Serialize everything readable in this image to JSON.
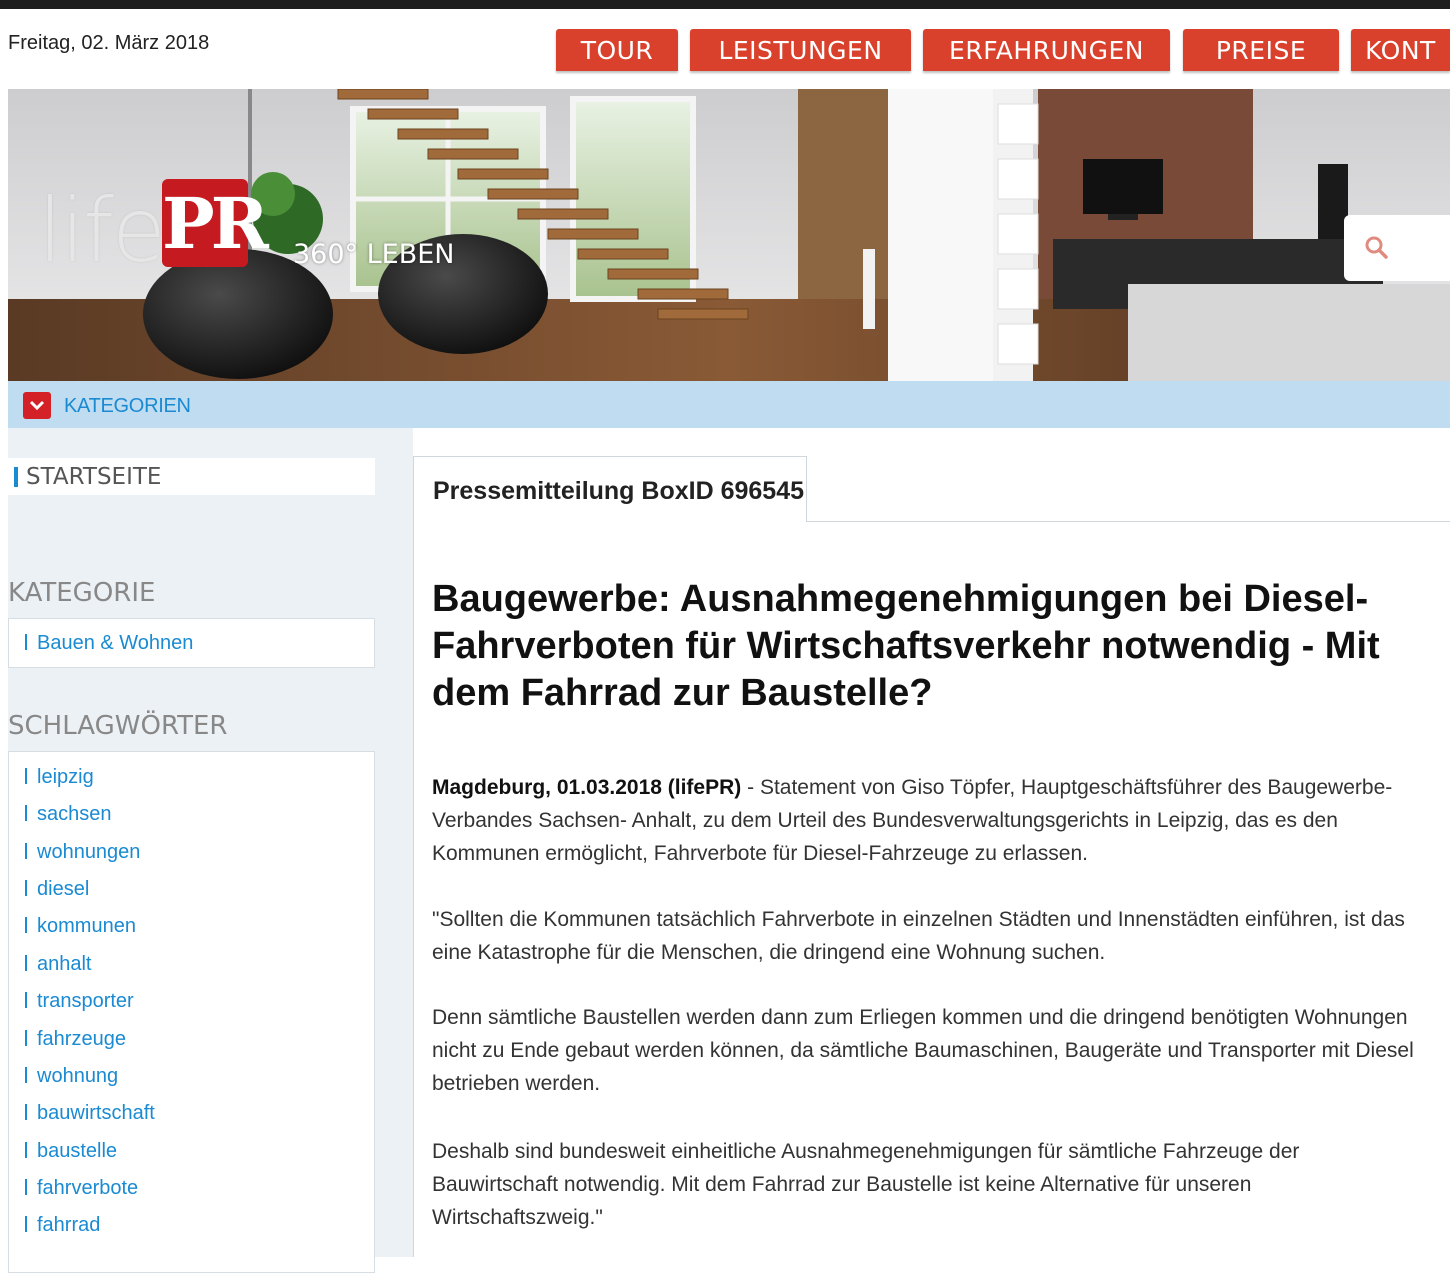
{
  "header": {
    "date": "Freitag, 02. März 2018",
    "nav": [
      "TOUR",
      "LEISTUNGEN",
      "ERFAHRUNGEN",
      "PREISE",
      "KONT"
    ]
  },
  "hero": {
    "logo_text": "life",
    "logo_badge": "PR",
    "tagline": "360° LEBEN",
    "search_icon": "search-icon"
  },
  "category_bar": {
    "label": "KATEGORIEN",
    "icon": "chevron-down-icon"
  },
  "sidebar": {
    "start": "STARTSEITE",
    "kategorie_title": "KATEGORIE",
    "kategorie_items": [
      "Bauen & Wohnen"
    ],
    "tags_title": "SCHLAGWÖRTER",
    "tags": [
      "leipzig",
      "sachsen",
      "wohnungen",
      "diesel",
      "kommunen",
      "anhalt",
      "transporter",
      "fahrzeuge",
      "wohnung",
      "bauwirtschaft",
      "baustelle",
      "fahrverbote",
      "fahrrad"
    ]
  },
  "article": {
    "tab": "Pressemitteilung BoxID 696545",
    "headline": "Baugewerbe: Ausnahmegenehmigungen bei Diesel-Fahrverboten für Wirtschaftsverkehr notwendig - Mit dem Fahrrad zur Baustelle?",
    "dateline": "Magdeburg, 01.03.2018 (lifePR)",
    "lead": " - Statement von Giso Töpfer, Hauptgeschäftsführer des Baugewerbe-Verbandes Sachsen- Anhalt, zu dem Urteil des Bundesverwaltungsgerichts in Leipzig, das es den Kommunen ermöglicht, Fahrverbote für Diesel-Fahrzeuge zu erlassen.",
    "paragraphs": [
      "\"Sollten die Kommunen tatsächlich Fahrverbote in einzelnen Städten und Innenstädten einführen, ist das eine Katastrophe für die Menschen, die dringend eine Wohnung suchen.",
      "Denn sämtliche Baustellen werden dann zum Erliegen kommen und die dringend benötigten Wohnungen nicht zu Ende gebaut werden können, da sämtliche Baumaschinen, Baugeräte und Transporter mit Diesel betrieben werden.",
      "Deshalb sind bundesweit einheitliche Ausnahmegenehmigungen für sämtliche Fahrzeuge der Bauwirtschaft notwendig. Mit dem Fahrrad zur Baustelle ist keine Alternative für unseren Wirtschaftszweig.\""
    ]
  },
  "colors": {
    "nav_red": "#d9412c",
    "link_blue": "#1a8ad2",
    "catbar_bg": "#bfdcf0",
    "sidebar_bg": "#ecf1f5"
  }
}
